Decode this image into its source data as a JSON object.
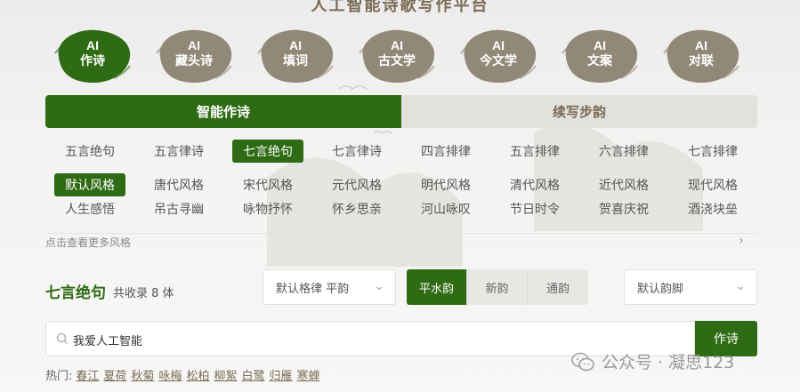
{
  "page_title": "人工智能诗歌写作平台",
  "modes": [
    {
      "line1": "AI",
      "line2": "作诗",
      "active": true
    },
    {
      "line1": "AI",
      "line2": "藏头诗",
      "active": false
    },
    {
      "line1": "AI",
      "line2": "填词",
      "active": false
    },
    {
      "line1": "AI",
      "line2": "古文学",
      "active": false
    },
    {
      "line1": "AI",
      "line2": "今文学",
      "active": false
    },
    {
      "line1": "AI",
      "line2": "文案",
      "active": false
    },
    {
      "line1": "AI",
      "line2": "对联",
      "active": false
    }
  ],
  "tabs": {
    "smart": "智能作诗",
    "continue": "续写步韵"
  },
  "forms": [
    "五言绝句",
    "五言律诗",
    "七言绝句",
    "七言律诗",
    "四言排律",
    "五言排律",
    "六言排律",
    "七言排律"
  ],
  "styles_row1": [
    "默认风格",
    "唐代风格",
    "宋代风格",
    "元代风格",
    "明代风格",
    "清代风格",
    "近代风格",
    "现代风格"
  ],
  "styles_row2": [
    "人生感悟",
    "吊古寻幽",
    "咏物抒怀",
    "怀乡思亲",
    "河山咏叹",
    "节日时令",
    "贺喜庆祝",
    "酒浇块垒"
  ],
  "more_styles": "点击查看更多风格",
  "form_title": "七言绝句",
  "form_count": "共收录 8 体",
  "meter_select": "默认格律 平韵",
  "rhyme_options": [
    "平水韵",
    "新韵",
    "通韵"
  ],
  "rhyme_foot_select": "默认韵脚",
  "search": {
    "value": "我爱人工智能"
  },
  "write_button": "作诗",
  "hot_label": "热门:",
  "hot_items": [
    "春江",
    "夏荷",
    "秋菊",
    "咏梅",
    "松柏",
    "柳絮",
    "白鹭",
    "归雁",
    "寒蝉"
  ],
  "watermark": "公众号 · 凝思123",
  "colors": {
    "accent": "#2f6b14",
    "ink": "#918877",
    "tab_inactive": "#e2e1dd"
  }
}
